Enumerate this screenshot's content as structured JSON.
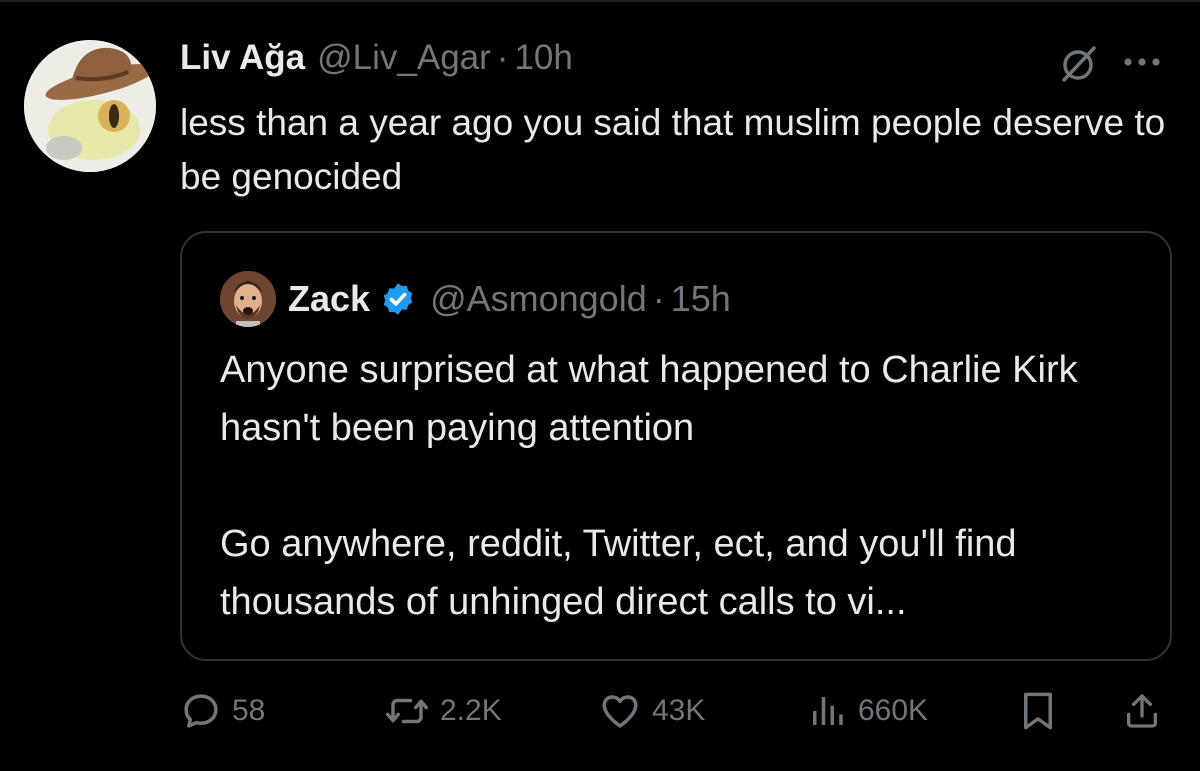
{
  "tweet": {
    "author": {
      "display_name": "Liv Ağa",
      "handle": "@Liv_Agar",
      "separator": "·",
      "time": "10h"
    },
    "text": "less than a year ago you said that muslim people deserve to be genocided"
  },
  "quoted_tweet": {
    "author": {
      "display_name": "Zack",
      "handle": "@Asmongold",
      "separator": "·",
      "time": "15h",
      "verified": true
    },
    "text": "Anyone surprised at what happened to Charlie Kirk hasn't been paying attention\n\nGo anywhere, reddit, Twitter, ect, and you'll find thousands of unhinged direct calls to vi..."
  },
  "actions": {
    "replies": "58",
    "reposts": "2.2K",
    "likes": "43K",
    "views": "660K"
  },
  "icons": {
    "grok": "grok-icon",
    "more": "more-icon",
    "reply": "reply-icon",
    "repost": "repost-icon",
    "like": "heart-icon",
    "views": "views-icon",
    "bookmark": "bookmark-icon",
    "share": "share-icon",
    "verified": "verified-badge-icon"
  },
  "colors": {
    "background": "#000000",
    "text_primary": "#e7e9ea",
    "text_secondary": "#71767b",
    "border": "#2f3336",
    "verified_blue": "#1d9bf0"
  }
}
